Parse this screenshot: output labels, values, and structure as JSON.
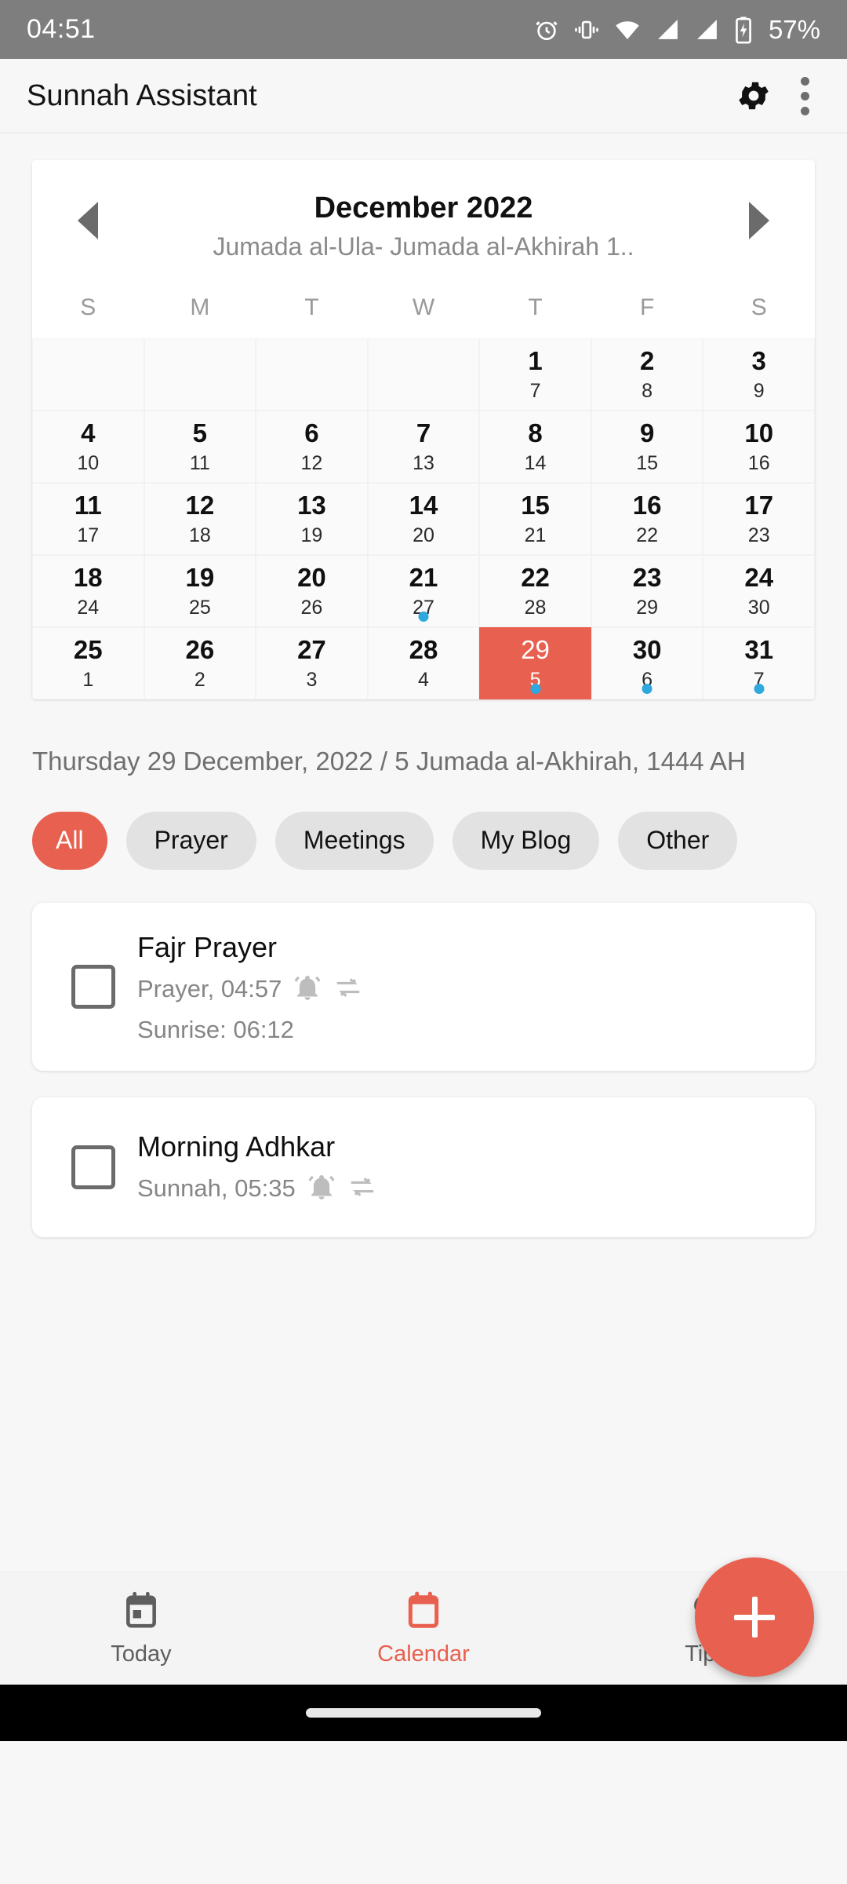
{
  "status_bar": {
    "time": "04:51",
    "battery_text": "57%",
    "icons": [
      "alarm-icon",
      "vibrate-icon",
      "wifi-icon",
      "signal-icon",
      "signal-icon",
      "battery-charging-icon"
    ]
  },
  "app_bar": {
    "title": "Sunnah Assistant",
    "settings_icon": "gear-icon",
    "overflow_icon": "more-vertical-icon"
  },
  "calendar": {
    "month_label": "December 2022",
    "hijri_label": "Jumada al-Ula- Jumada al-Akhirah 1..",
    "prev_icon": "chevron-left-icon",
    "next_icon": "chevron-right-icon",
    "weekdays": [
      "S",
      "M",
      "T",
      "W",
      "T",
      "F",
      "S"
    ],
    "leading_blanks": 4,
    "days": [
      {
        "g": "1",
        "h": "7"
      },
      {
        "g": "2",
        "h": "8"
      },
      {
        "g": "3",
        "h": "9"
      },
      {
        "g": "4",
        "h": "10"
      },
      {
        "g": "5",
        "h": "11"
      },
      {
        "g": "6",
        "h": "12"
      },
      {
        "g": "7",
        "h": "13"
      },
      {
        "g": "8",
        "h": "14"
      },
      {
        "g": "9",
        "h": "15"
      },
      {
        "g": "10",
        "h": "16"
      },
      {
        "g": "11",
        "h": "17"
      },
      {
        "g": "12",
        "h": "18"
      },
      {
        "g": "13",
        "h": "19"
      },
      {
        "g": "14",
        "h": "20"
      },
      {
        "g": "15",
        "h": "21"
      },
      {
        "g": "16",
        "h": "22"
      },
      {
        "g": "17",
        "h": "23"
      },
      {
        "g": "18",
        "h": "24"
      },
      {
        "g": "19",
        "h": "25"
      },
      {
        "g": "20",
        "h": "26"
      },
      {
        "g": "21",
        "h": "27",
        "dot": true
      },
      {
        "g": "22",
        "h": "28"
      },
      {
        "g": "23",
        "h": "29"
      },
      {
        "g": "24",
        "h": "30"
      },
      {
        "g": "25",
        "h": "1"
      },
      {
        "g": "26",
        "h": "2"
      },
      {
        "g": "27",
        "h": "3"
      },
      {
        "g": "28",
        "h": "4"
      },
      {
        "g": "29",
        "h": "5",
        "dot": true,
        "selected": true
      },
      {
        "g": "30",
        "h": "6",
        "dot": true
      },
      {
        "g": "31",
        "h": "7",
        "dot": true
      }
    ]
  },
  "selected_date_line": "Thursday 29 December, 2022 / 5 Jumada al-Akhirah, 1444 AH",
  "filters": [
    {
      "label": "All",
      "active": true
    },
    {
      "label": "Prayer",
      "active": false
    },
    {
      "label": "Meetings",
      "active": false
    },
    {
      "label": "My Blog",
      "active": false
    },
    {
      "label": "Other",
      "active": false
    }
  ],
  "tasks": [
    {
      "title": "Fajr Prayer",
      "subtitle": "Prayer, 04:57",
      "extra": "Sunrise:  06:12",
      "checked": false,
      "alarm_icon": "bell-icon",
      "repeat_icon": "repeat-icon"
    },
    {
      "title": "Morning Adhkar",
      "subtitle": "Sunnah, 05:35",
      "extra": "",
      "checked": false,
      "alarm_icon": "bell-icon",
      "repeat_icon": "repeat-icon"
    }
  ],
  "fab": {
    "icon": "plus-icon"
  },
  "bottom_nav": [
    {
      "label": "Today",
      "icon": "calendar-today-icon",
      "active": false
    },
    {
      "label": "Calendar",
      "icon": "calendar-icon",
      "active": true
    },
    {
      "label": "Tips",
      "icon": "lightbulb-icon",
      "active": false
    }
  ],
  "colors": {
    "accent": "#E8604F",
    "event_dot": "#2FA8DF",
    "status_bar_bg": "#7E7E7E",
    "page_bg": "#F7F7F7"
  }
}
